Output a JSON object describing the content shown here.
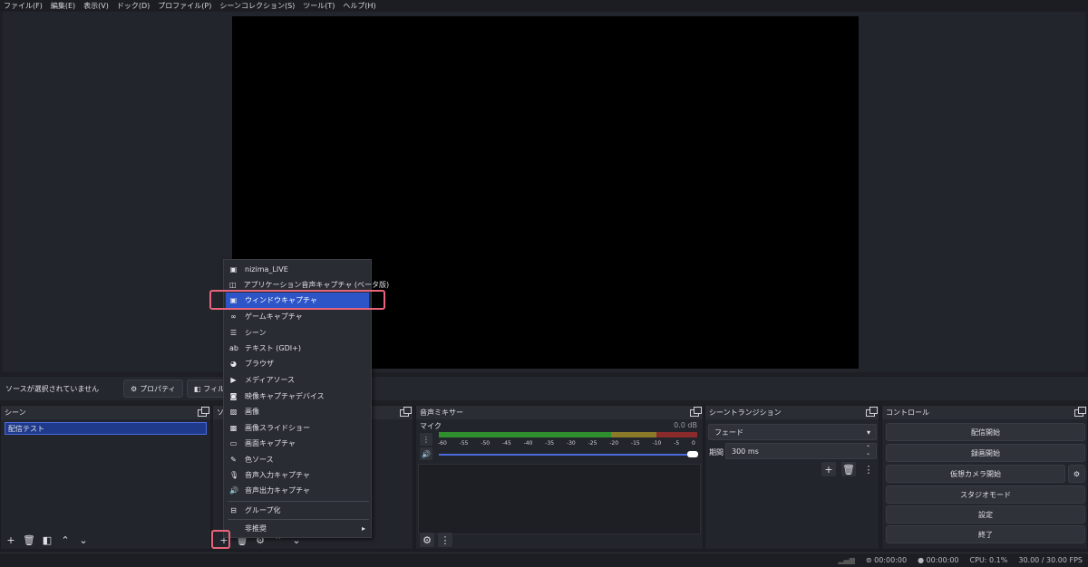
{
  "menu": [
    "ファイル(F)",
    "編集(E)",
    "表示(V)",
    "ドック(D)",
    "プロファイル(P)",
    "シーンコレクション(S)",
    "ツール(T)",
    "ヘルプ(H)"
  ],
  "source_bar": {
    "no_source": "ソースが選択されていません",
    "properties": "プロパティ",
    "filters": "フィルタ"
  },
  "scenes": {
    "title": "シーン",
    "items": [
      "配信テスト"
    ]
  },
  "sources": {
    "title": "ソ"
  },
  "mixer": {
    "title": "音声ミキサー",
    "channel": "マイク",
    "level": "0.0 dB",
    "ticks": [
      "-60",
      "-55",
      "-50",
      "-45",
      "-40",
      "-35",
      "-30",
      "-25",
      "-20",
      "-15",
      "-10",
      "-5",
      "0"
    ],
    "volume": 100
  },
  "transitions": {
    "title": "シーントランジション",
    "selected": "フェード",
    "duration_label": "期間",
    "duration_value": "300 ms"
  },
  "controls": {
    "title": "コントロール",
    "buttons": [
      "配信開始",
      "録画開始",
      "仮想カメラ開始",
      "スタジオモード",
      "設定",
      "終了"
    ]
  },
  "context_menu": {
    "items": [
      "nizima_LIVE",
      "アプリケーション音声キャプチャ (ベータ版)",
      "ウィンドウキャプチャ",
      "ゲームキャプチャ",
      "シーン",
      "テキスト (GDI+)",
      "ブラウザ",
      "メディアソース",
      "映像キャプチャデバイス",
      "画像",
      "画像スライドショー",
      "画面キャプチャ",
      "色ソース",
      "音声入力キャプチャ",
      "音声出力キャプチャ"
    ],
    "group": "グループ化",
    "deprecated": "非推奨",
    "selected_index": 2
  },
  "status": {
    "stream_time": "00:00:00",
    "rec_time": "00:00:00",
    "cpu": "CPU: 0.1%",
    "fps": "30.00 / 30.00 FPS"
  },
  "colors": {
    "accent": "#2d55c8",
    "highlight": "#e8647a",
    "meter_green": "#2f8f2f",
    "meter_yellow": "#8a7a2a",
    "meter_red": "#8a2a2a"
  }
}
